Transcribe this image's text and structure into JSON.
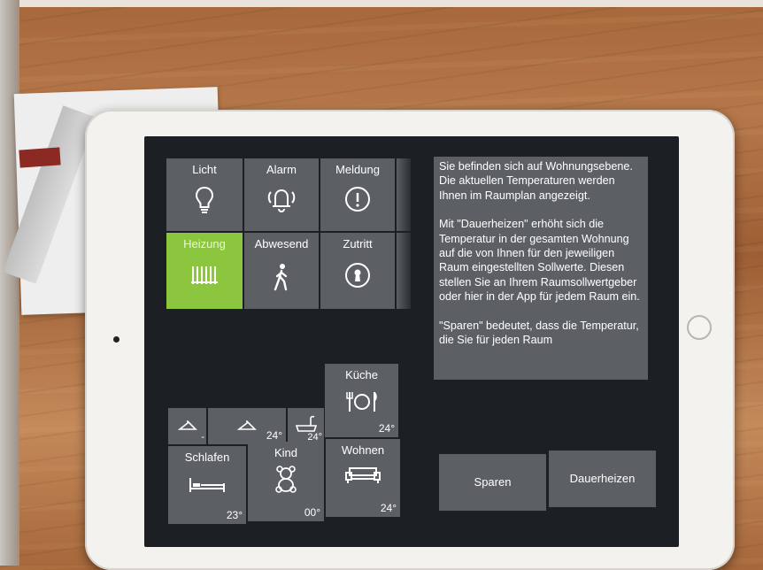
{
  "mode_tiles": [
    {
      "label": "Licht",
      "icon": "bulb-icon"
    },
    {
      "label": "Alarm",
      "icon": "alarm-bell-icon"
    },
    {
      "label": "Meldung",
      "icon": "exclamation-icon"
    },
    {
      "label": "Heizung",
      "icon": "radiator-icon",
      "active": true
    },
    {
      "label": "Abwesend",
      "icon": "walking-person-icon"
    },
    {
      "label": "Zutritt",
      "icon": "keyhole-icon"
    }
  ],
  "info_text": [
    "Sie befinden sich auf Wohnungsebene. Die aktuellen Temperaturen werden Ihnen im Raumplan angezeigt.",
    "Mit \"Dauerheizen\" erhöht sich die Temperatur in der gesamten Wohnung auf die von Ihnen für den jeweiligen Raum eingestellten Sollwerte. Diesen stellen Sie an Ihrem Raumsollwertgeber oder hier in der App für jedem Raum ein.",
    "\"Sparen\" bedeutet, dass die Temperatur, die Sie für jeden Raum"
  ],
  "rooms": {
    "kueche": {
      "label": "Küche",
      "temp": "24°",
      "icon": "plate-cutlery-icon"
    },
    "schlafen": {
      "label": "Schlafen",
      "temp": "23°",
      "icon": "bed-icon"
    },
    "kind": {
      "label": "Kind",
      "temp": "00°",
      "icon": "teddy-bear-icon"
    },
    "wohnen": {
      "label": "Wohnen",
      "temp": "24°",
      "icon": "sofa-icon"
    },
    "small": [
      {
        "icon": "hanger-icon",
        "temp": "-"
      },
      {
        "icon": "hanger-icon",
        "temp": "24°"
      },
      {
        "icon": "bathtub-icon",
        "temp": "24°"
      }
    ]
  },
  "actions": {
    "sparen": "Sparen",
    "dauerheizen": "Dauerheizen"
  },
  "colors": {
    "tile": "#5c6064",
    "active_tile": "#8cc63f",
    "screen_bg": "#1c2024"
  }
}
